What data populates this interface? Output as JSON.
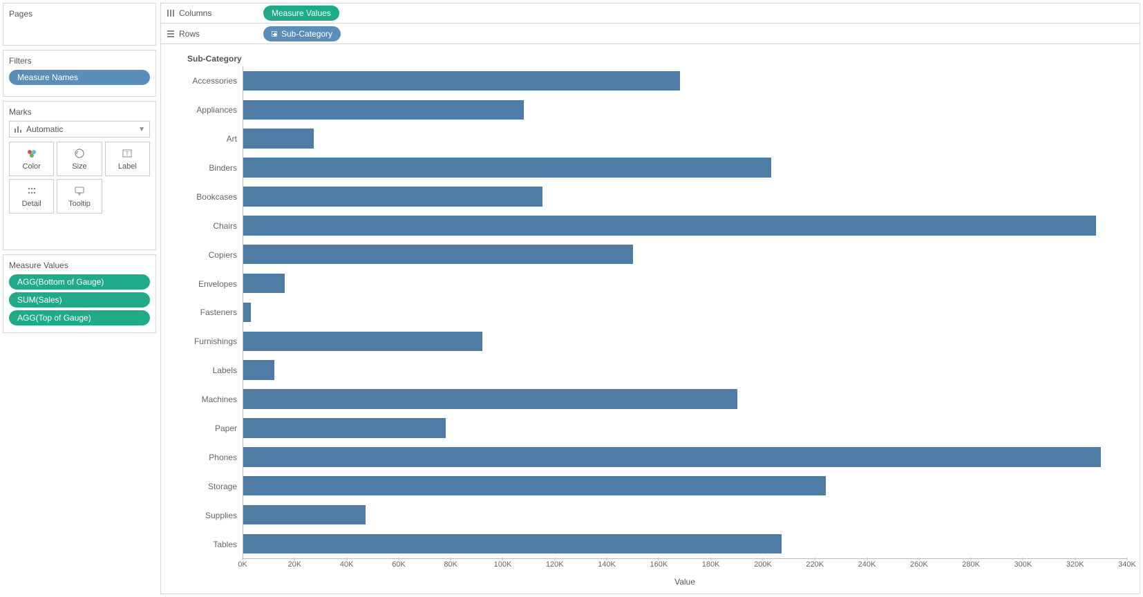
{
  "left": {
    "pages_title": "Pages",
    "filters_title": "Filters",
    "filters_pill": "Measure Names",
    "marks_title": "Marks",
    "marks_select": "Automatic",
    "marks_buttons": {
      "color": "Color",
      "size": "Size",
      "label": "Label",
      "detail": "Detail",
      "tooltip": "Tooltip"
    },
    "mv_title": "Measure Values",
    "mv_pills": [
      "AGG(Bottom of Gauge)",
      "SUM(Sales)",
      "AGG(Top of Gauge)"
    ]
  },
  "shelves": {
    "columns_label": "Columns",
    "columns_pill": "Measure Values",
    "rows_label": "Rows",
    "rows_pill": "Sub-Category"
  },
  "chart_data": {
    "type": "bar",
    "orientation": "horizontal",
    "title": "Sub-Category",
    "xlabel": "Value",
    "ylabel": "",
    "xlim": [
      0,
      340000
    ],
    "x_ticks": [
      0,
      20000,
      40000,
      60000,
      80000,
      100000,
      120000,
      140000,
      160000,
      180000,
      200000,
      220000,
      240000,
      260000,
      280000,
      300000,
      320000,
      340000
    ],
    "x_tick_labels": [
      "0K",
      "20K",
      "40K",
      "60K",
      "80K",
      "100K",
      "120K",
      "140K",
      "160K",
      "180K",
      "200K",
      "220K",
      "240K",
      "260K",
      "280K",
      "300K",
      "320K",
      "340K"
    ],
    "categories": [
      "Accessories",
      "Appliances",
      "Art",
      "Binders",
      "Bookcases",
      "Chairs",
      "Copiers",
      "Envelopes",
      "Fasteners",
      "Furnishings",
      "Labels",
      "Machines",
      "Paper",
      "Phones",
      "Storage",
      "Supplies",
      "Tables"
    ],
    "values": [
      168000,
      108000,
      27000,
      203000,
      115000,
      328000,
      150000,
      16000,
      3000,
      92000,
      12000,
      190000,
      78000,
      330000,
      224000,
      47000,
      207000
    ],
    "bar_color": "#4f7ca5"
  }
}
